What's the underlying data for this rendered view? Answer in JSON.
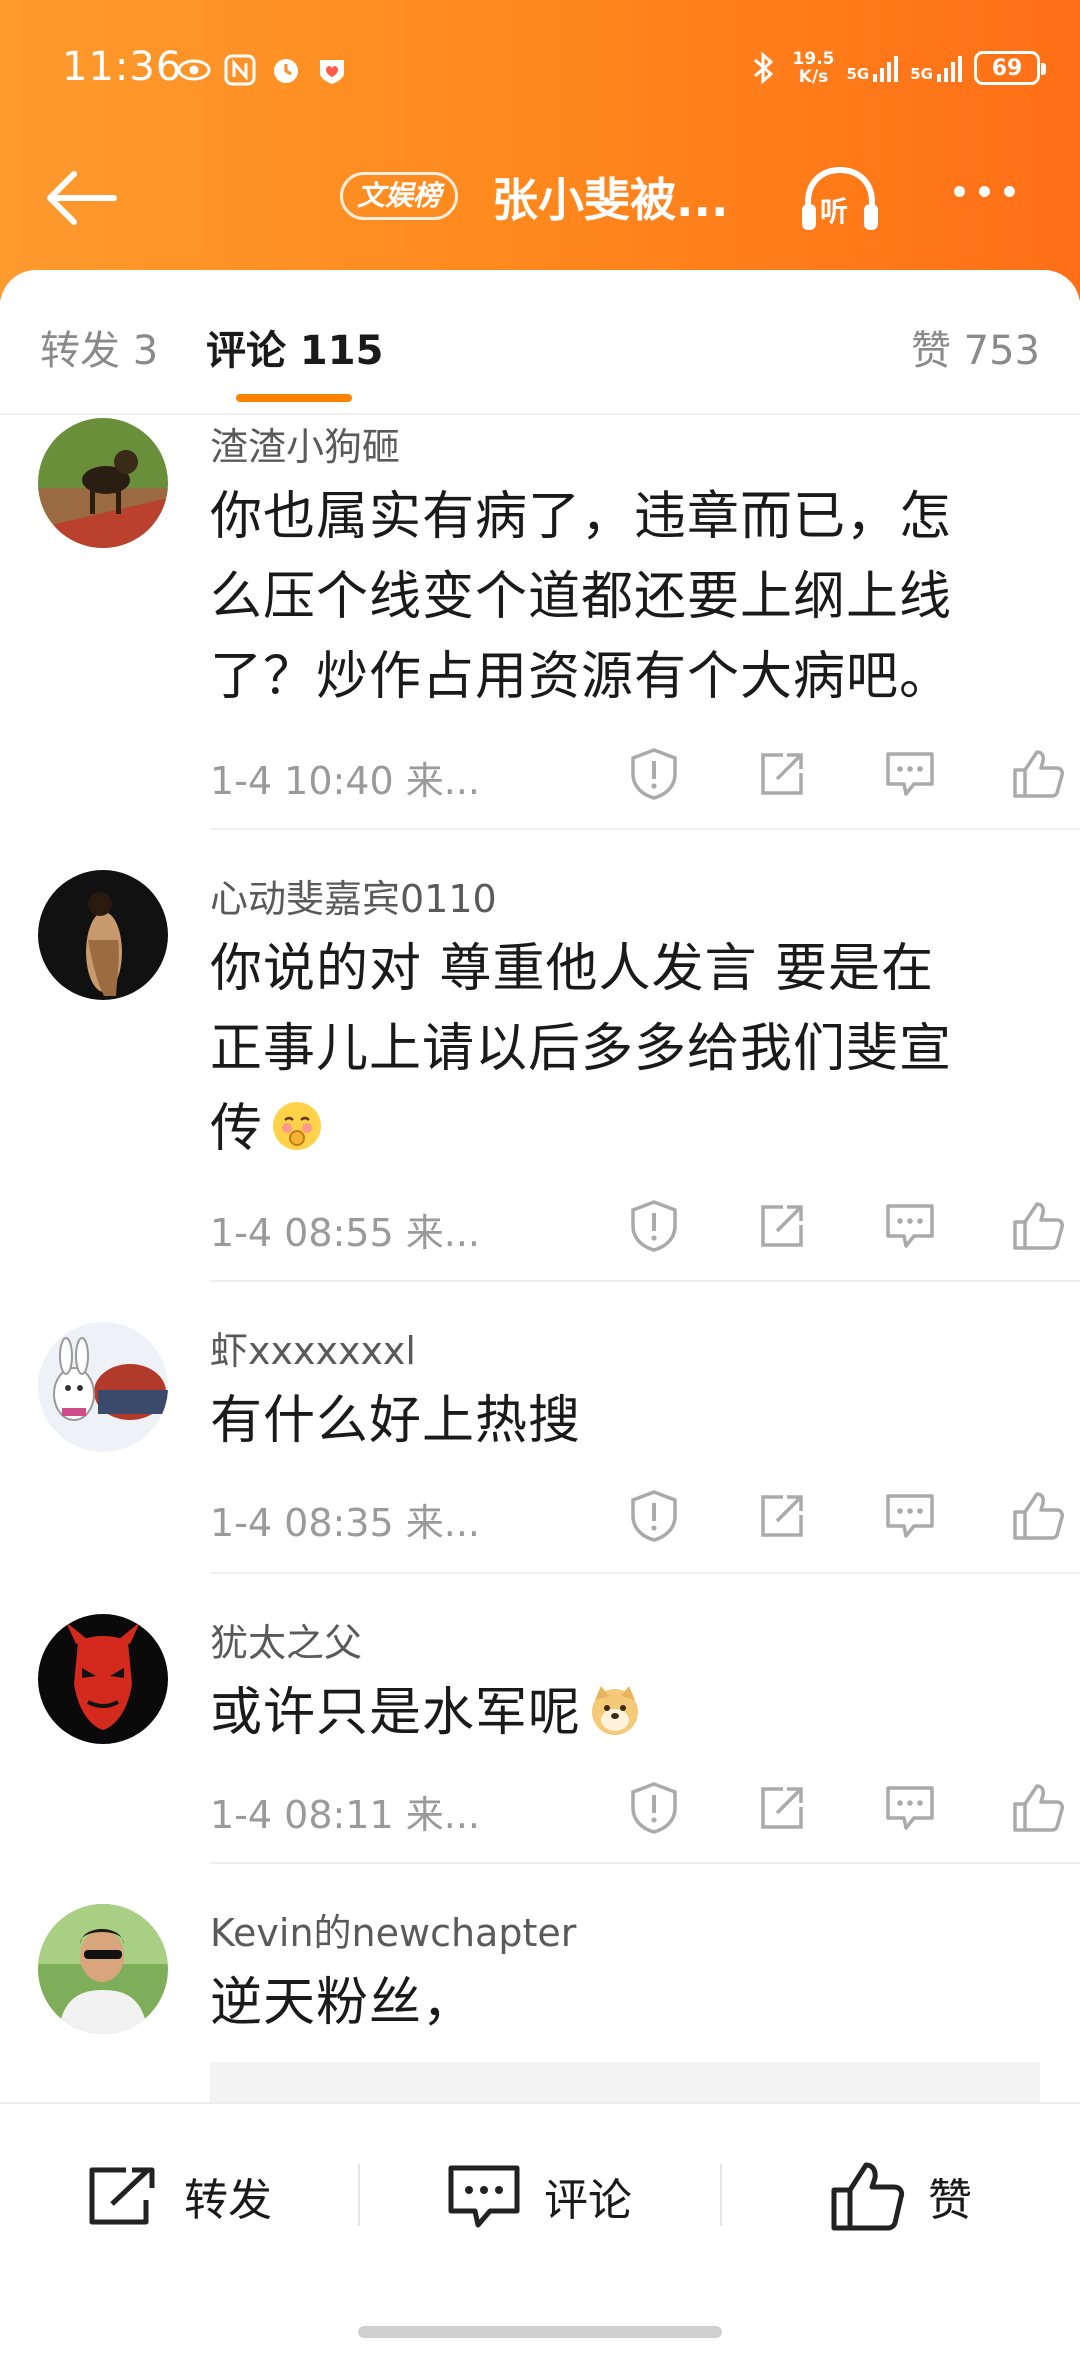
{
  "status_bar": {
    "time": "11:36",
    "net_speed_value": "19.5",
    "net_speed_unit": "K/s",
    "net1": "5G",
    "net2": "5G",
    "battery": "69"
  },
  "nav": {
    "badge": "文娱榜",
    "title": "张小斐被...",
    "listen_label": "听"
  },
  "tabs": {
    "repost": "转发 3",
    "comment": "评论 115",
    "like": "赞 753"
  },
  "comments": [
    {
      "name": "渣渣小狗砸",
      "text_lines": [
        "你也属实有病了，违章而已，怎",
        "么压个线变个道都还要上纲上线",
        "了？炒作占用资源有个大病吧。"
      ],
      "meta": "1-4 10:40 来..."
    },
    {
      "name": "心动斐嘉宾0110",
      "text_lines": [
        "你说的对 尊重他人发言 要是在",
        "正事儿上请以后多多给我们斐宣",
        "传"
      ],
      "meta": "1-4 08:55 来..."
    },
    {
      "name": "虾xxxxxxxl",
      "text_lines": [
        "有什么好上热搜"
      ],
      "meta": "1-4 08:35 来..."
    },
    {
      "name": "犹太之父",
      "text_lines": [
        "或许只是水军呢"
      ],
      "meta": "1-4 08:11 来..."
    },
    {
      "name": "Kevin的newchapter",
      "text_lines": [
        "逆天粉丝，"
      ],
      "meta": ""
    }
  ],
  "bottom_bar": {
    "repost": "转发",
    "comment": "评论",
    "like": "赞"
  },
  "colors": {
    "header_start": "#ff9a2e",
    "header_end": "#ff6f16",
    "accent": "#ff8200"
  }
}
